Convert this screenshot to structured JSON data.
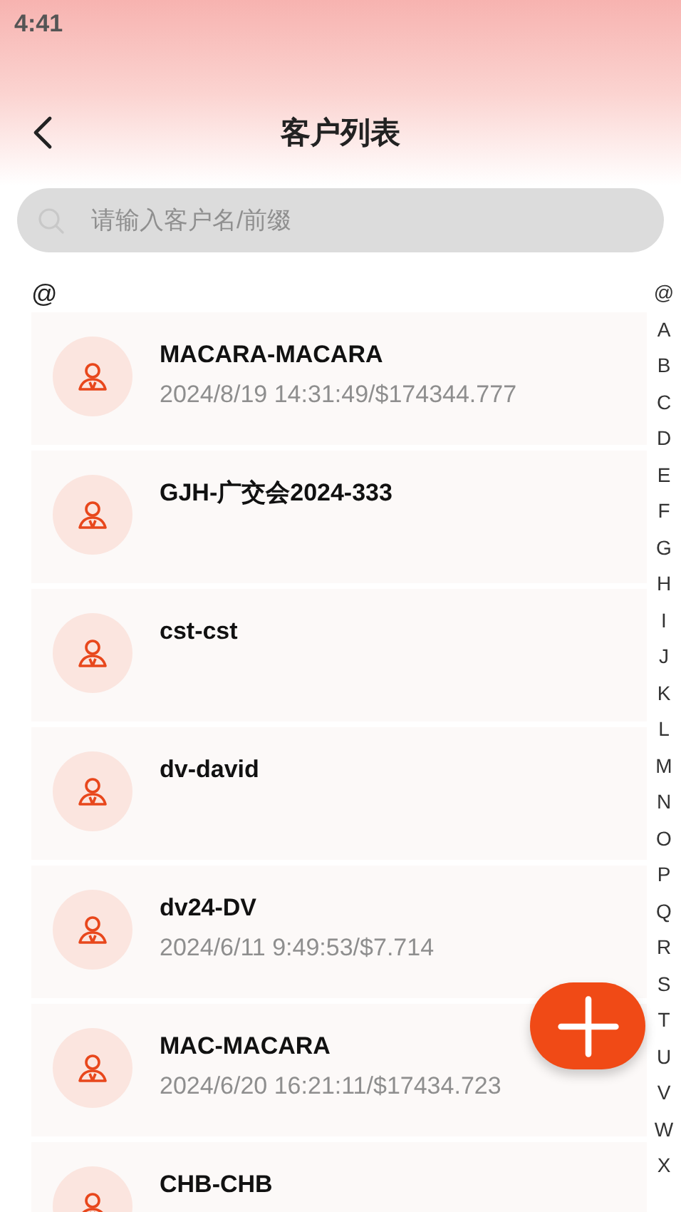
{
  "status_bar": {
    "time": "4:41"
  },
  "header": {
    "title": "客户列表"
  },
  "search": {
    "placeholder": "请输入客户名/前缀"
  },
  "section": {
    "label": "@"
  },
  "customers": [
    {
      "name": "MACARA-MACARA",
      "detail": "2024/8/19 14:31:49/$174344.777"
    },
    {
      "name": "GJH-广交会2024-333"
    },
    {
      "name": "cst-cst"
    },
    {
      "name": "dv-david"
    },
    {
      "name": "dv24-DV",
      "detail": "2024/6/11 9:49:53/$7.714"
    },
    {
      "name": "MAC-MACARA",
      "detail": "2024/6/20 16:21:11/$17434.723"
    },
    {
      "name": "CHB-CHB"
    }
  ],
  "index_letters": [
    "@",
    "A",
    "B",
    "C",
    "D",
    "E",
    "F",
    "G",
    "H",
    "I",
    "J",
    "K",
    "L",
    "M",
    "N",
    "O",
    "P",
    "Q",
    "R",
    "S",
    "T",
    "U",
    "V",
    "W",
    "X"
  ]
}
